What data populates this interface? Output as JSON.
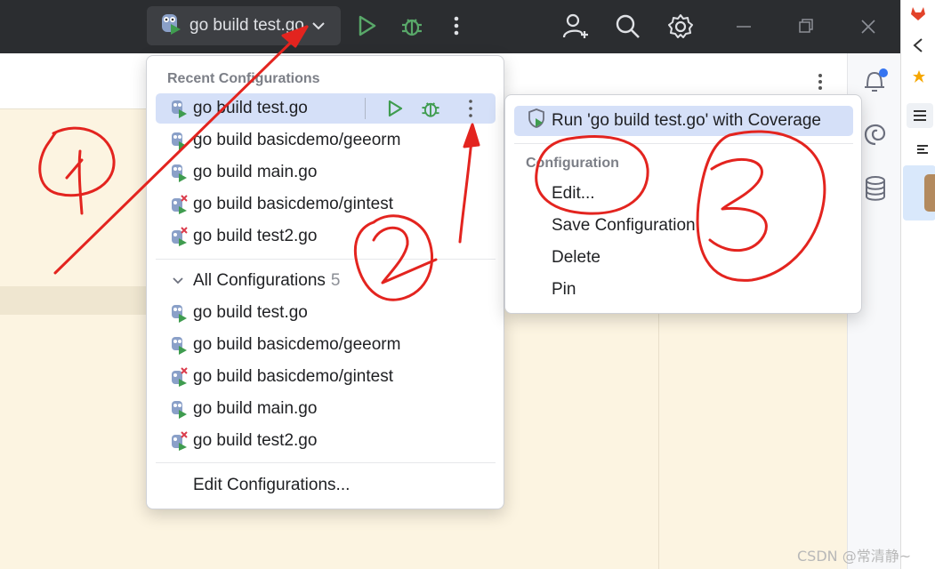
{
  "titlebar": {
    "run_config_label": "go build test.go",
    "icons": [
      "gopher-icon",
      "chevron-down-icon",
      "run-icon",
      "debug-icon",
      "more-vertical-icon",
      "add-user-icon",
      "search-icon",
      "gear-icon",
      "minimize-icon",
      "restore-icon",
      "close-icon"
    ]
  },
  "run_popup": {
    "recent_title": "Recent Configurations",
    "recent_items": [
      {
        "label": "go build test.go",
        "error": false,
        "selected": true
      },
      {
        "label": "go build basicdemo/geeorm",
        "error": false,
        "selected": false
      },
      {
        "label": "go build main.go",
        "error": false,
        "selected": false
      },
      {
        "label": "go build basicdemo/gintest",
        "error": true,
        "selected": false
      },
      {
        "label": "go build test2.go",
        "error": true,
        "selected": false
      }
    ],
    "all_title": "All Configurations",
    "all_count": "5",
    "all_items": [
      {
        "label": "go build test.go",
        "error": false
      },
      {
        "label": "go build basicdemo/geeorm",
        "error": false
      },
      {
        "label": "go build basicdemo/gintest",
        "error": true
      },
      {
        "label": "go build main.go",
        "error": false
      },
      {
        "label": "go build test2.go",
        "error": true
      }
    ],
    "edit_configurations": "Edit Configurations..."
  },
  "sub_popup": {
    "run_with_coverage": "Run 'go build test.go' with Coverage",
    "section_title": "Configuration",
    "items": [
      "Edit...",
      "Save Configuration",
      "Delete",
      "Pin"
    ]
  },
  "colors": {
    "accent_green": "#3f9c4f",
    "annotation_red": "#e3241f",
    "selection": "#d5e0f8",
    "titlebar_bg": "#2b2d30"
  },
  "watermark": "CSDN @常清静~"
}
